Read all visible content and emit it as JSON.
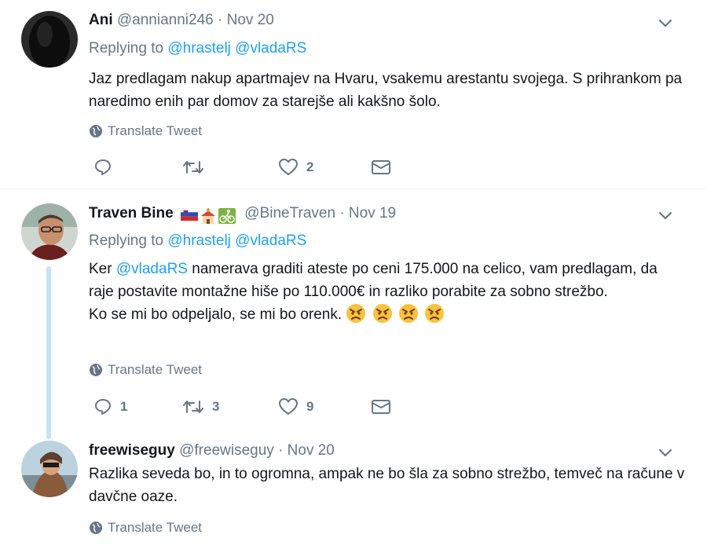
{
  "tweets": [
    {
      "name": "Ani",
      "handle": "@annianni246",
      "separator": "·",
      "date": "Nov 20",
      "replying_prefix": "Replying to",
      "replying_to": [
        "@hrastelj",
        "@vladaRS"
      ],
      "text": "Jaz predlagam nakup apartmajev na Hvaru, vsakemu arestantu svojega. S prihrankom pa naredimo enih par domov za starejše ali kakšno šolo.",
      "translate": "Translate Tweet",
      "replies": "",
      "retweets": "",
      "likes": "2"
    },
    {
      "name": "Traven Bine",
      "handle": "@BineTraven",
      "separator": "·",
      "date": "Nov 19",
      "replying_prefix": "Replying to",
      "replying_to": [
        "@hrastelj",
        "@vladaRS"
      ],
      "text_part1": "Ker ",
      "text_mention": "@vladaRS",
      "text_part2": " namerava graditi  ateste po ceni 175.000 na celico, vam predlagam, da raje postavite montažne hiše po 110.000€ in razliko porabite za sobno strežbo.",
      "text_line2": "Ko se mi bo odpeljalo, se mi bo orenk.",
      "translate": "Translate Tweet",
      "replies": "1",
      "retweets": "3",
      "likes": "9"
    },
    {
      "name": "freewiseguy",
      "handle": "@freewiseguy",
      "separator": "·",
      "date": "Nov 20",
      "text": "Razlika seveda bo, in to ogromna, ampak ne bo šla za sobno strežbo, temveč na račune v davčne oaze.",
      "translate": "Translate Tweet"
    }
  ],
  "icons": {
    "reply": "reply-icon",
    "retweet": "retweet-icon",
    "like": "heart-icon",
    "dm": "envelope-icon",
    "globe": "globe-icon",
    "chevron": "chevron-down-icon"
  },
  "colors": {
    "link": "#1da1f2",
    "muted": "#657786",
    "text": "#14171a",
    "thread_line": "#c4e4f8"
  }
}
